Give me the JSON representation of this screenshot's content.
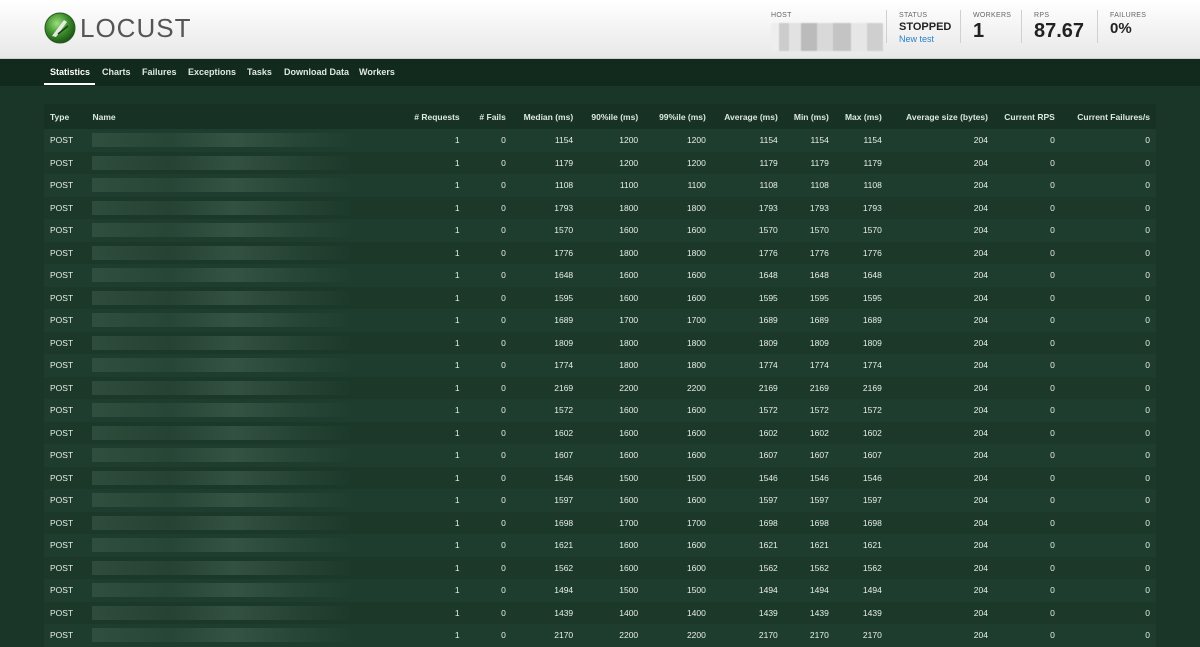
{
  "brand": {
    "name": "LOCUST"
  },
  "header": {
    "host_label": "HOST",
    "status_label": "STATUS",
    "status_value": "STOPPED",
    "new_test_label": "New test",
    "workers_label": "WORKERS",
    "workers_value": "1",
    "rps_label": "RPS",
    "rps_value": "87.67",
    "failures_label": "FAILURES",
    "failures_value": "0%"
  },
  "nav": {
    "tabs": [
      "Statistics",
      "Charts",
      "Failures",
      "Exceptions",
      "Tasks",
      "Download Data",
      "Workers"
    ],
    "active": "Statistics"
  },
  "table": {
    "columns": [
      "Type",
      "Name",
      "# Requests",
      "# Fails",
      "Median (ms)",
      "90%ile (ms)",
      "99%ile (ms)",
      "Average (ms)",
      "Min (ms)",
      "Max (ms)",
      "Average size (bytes)",
      "Current RPS",
      "Current Failures/s"
    ],
    "rows": [
      [
        "POST",
        "",
        "1",
        "0",
        "1154",
        "1200",
        "1200",
        "1154",
        "1154",
        "1154",
        "204",
        "0",
        "0"
      ],
      [
        "POST",
        "",
        "1",
        "0",
        "1179",
        "1200",
        "1200",
        "1179",
        "1179",
        "1179",
        "204",
        "0",
        "0"
      ],
      [
        "POST",
        "",
        "1",
        "0",
        "1108",
        "1100",
        "1100",
        "1108",
        "1108",
        "1108",
        "204",
        "0",
        "0"
      ],
      [
        "POST",
        "",
        "1",
        "0",
        "1793",
        "1800",
        "1800",
        "1793",
        "1793",
        "1793",
        "204",
        "0",
        "0"
      ],
      [
        "POST",
        "",
        "1",
        "0",
        "1570",
        "1600",
        "1600",
        "1570",
        "1570",
        "1570",
        "204",
        "0",
        "0"
      ],
      [
        "POST",
        "",
        "1",
        "0",
        "1776",
        "1800",
        "1800",
        "1776",
        "1776",
        "1776",
        "204",
        "0",
        "0"
      ],
      [
        "POST",
        "",
        "1",
        "0",
        "1648",
        "1600",
        "1600",
        "1648",
        "1648",
        "1648",
        "204",
        "0",
        "0"
      ],
      [
        "POST",
        "",
        "1",
        "0",
        "1595",
        "1600",
        "1600",
        "1595",
        "1595",
        "1595",
        "204",
        "0",
        "0"
      ],
      [
        "POST",
        "",
        "1",
        "0",
        "1689",
        "1700",
        "1700",
        "1689",
        "1689",
        "1689",
        "204",
        "0",
        "0"
      ],
      [
        "POST",
        "",
        "1",
        "0",
        "1809",
        "1800",
        "1800",
        "1809",
        "1809",
        "1809",
        "204",
        "0",
        "0"
      ],
      [
        "POST",
        "",
        "1",
        "0",
        "1774",
        "1800",
        "1800",
        "1774",
        "1774",
        "1774",
        "204",
        "0",
        "0"
      ],
      [
        "POST",
        "",
        "1",
        "0",
        "2169",
        "2200",
        "2200",
        "2169",
        "2169",
        "2169",
        "204",
        "0",
        "0"
      ],
      [
        "POST",
        "",
        "1",
        "0",
        "1572",
        "1600",
        "1600",
        "1572",
        "1572",
        "1572",
        "204",
        "0",
        "0"
      ],
      [
        "POST",
        "",
        "1",
        "0",
        "1602",
        "1600",
        "1600",
        "1602",
        "1602",
        "1602",
        "204",
        "0",
        "0"
      ],
      [
        "POST",
        "",
        "1",
        "0",
        "1607",
        "1600",
        "1600",
        "1607",
        "1607",
        "1607",
        "204",
        "0",
        "0"
      ],
      [
        "POST",
        "",
        "1",
        "0",
        "1546",
        "1500",
        "1500",
        "1546",
        "1546",
        "1546",
        "204",
        "0",
        "0"
      ],
      [
        "POST",
        "",
        "1",
        "0",
        "1597",
        "1600",
        "1600",
        "1597",
        "1597",
        "1597",
        "204",
        "0",
        "0"
      ],
      [
        "POST",
        "",
        "1",
        "0",
        "1698",
        "1700",
        "1700",
        "1698",
        "1698",
        "1698",
        "204",
        "0",
        "0"
      ],
      [
        "POST",
        "",
        "1",
        "0",
        "1621",
        "1600",
        "1600",
        "1621",
        "1621",
        "1621",
        "204",
        "0",
        "0"
      ],
      [
        "POST",
        "",
        "1",
        "0",
        "1562",
        "1600",
        "1600",
        "1562",
        "1562",
        "1562",
        "204",
        "0",
        "0"
      ],
      [
        "POST",
        "",
        "1",
        "0",
        "1494",
        "1500",
        "1500",
        "1494",
        "1494",
        "1494",
        "204",
        "0",
        "0"
      ],
      [
        "POST",
        "",
        "1",
        "0",
        "1439",
        "1400",
        "1400",
        "1439",
        "1439",
        "1439",
        "204",
        "0",
        "0"
      ],
      [
        "POST",
        "",
        "1",
        "0",
        "2170",
        "2200",
        "2200",
        "2170",
        "2170",
        "2170",
        "204",
        "0",
        "0"
      ]
    ]
  }
}
